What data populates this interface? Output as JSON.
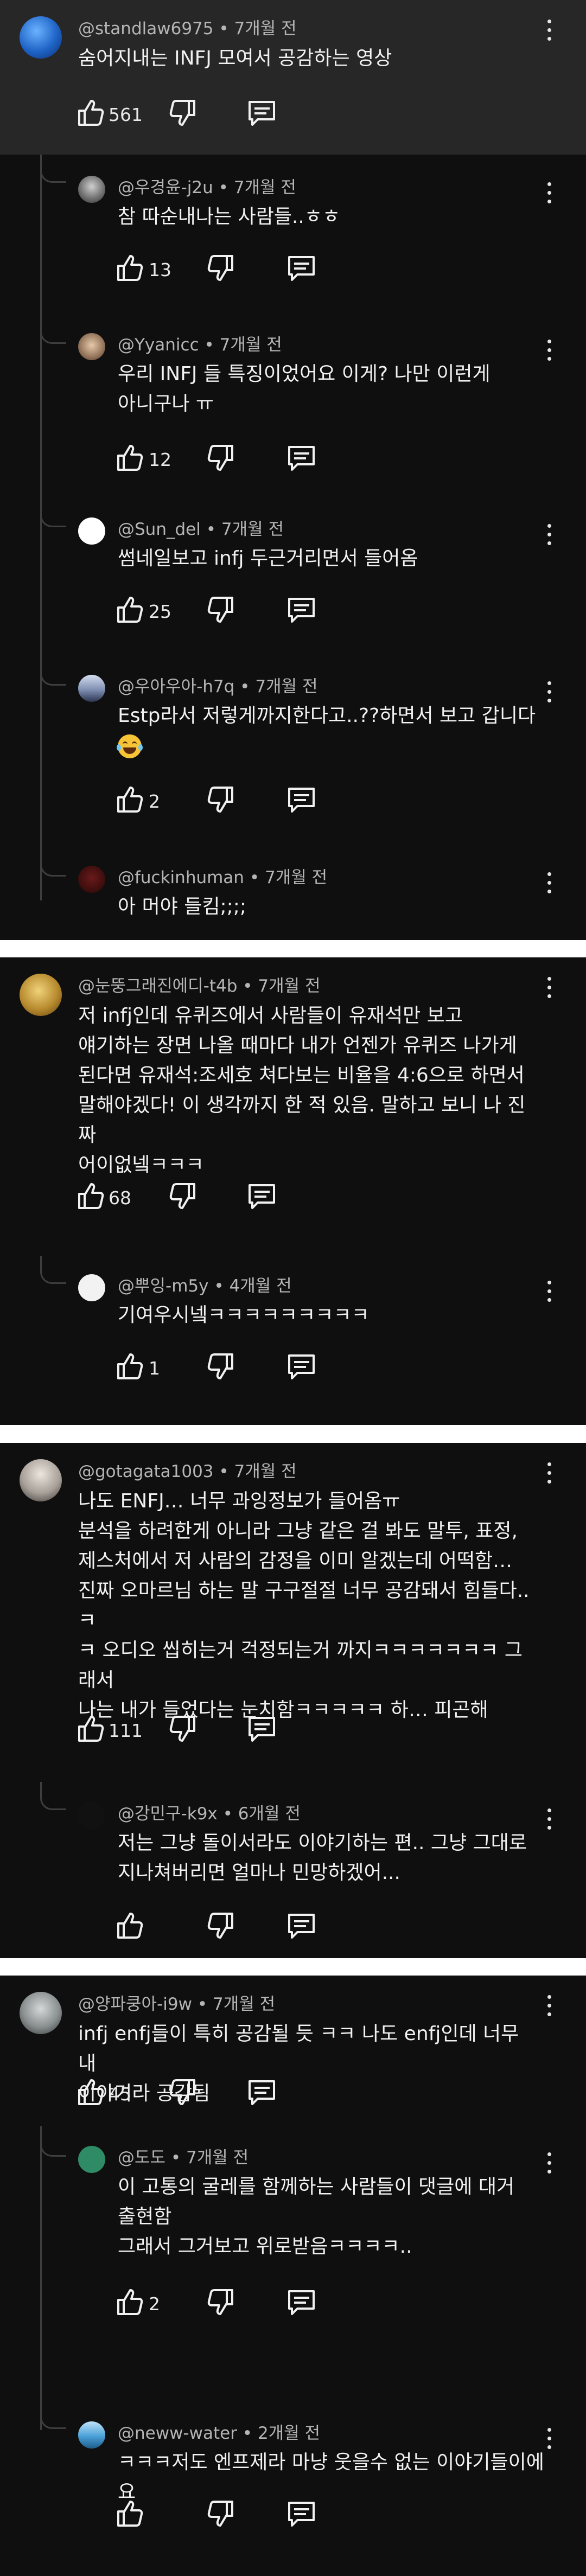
{
  "colors": {
    "background": "#0f0f0f",
    "highlight": "#272727",
    "separator": "#ffffff",
    "meta_text": "#b5b5b5",
    "body_text": "#f1f1f1"
  },
  "threads": [
    {
      "top": {
        "handle": "@standlaw6975",
        "time": "7개월 전",
        "text": "숨어지내는 INFJ 모여서 공감하는 영상",
        "likes": "561",
        "avatar_color": "#1e63c6"
      },
      "replies": [
        {
          "handle": "@우경윤-j2u",
          "time": "7개월 전",
          "text": "참 따순내나는 사람들..ㅎㅎ",
          "likes": "13",
          "avatar_color": "#7d7d7d"
        },
        {
          "handle": "@Yyanicc",
          "time": "7개월 전",
          "text": "우리 INFJ 들 특징이었어요 이게? 나만 이런게\n아니구나 ㅠ",
          "likes": "12",
          "avatar_color": "#9b7b61"
        },
        {
          "handle": "@Sun_del",
          "time": "7개월 전",
          "text": "썸네일보고 infj 두근거리면서 들어옴",
          "likes": "25",
          "avatar_color": "#ffffff"
        },
        {
          "handle": "@우아우아-h7q",
          "time": "7개월 전",
          "text": "Estp라서 저렇게까지한다고..??하면서 보고 갑니다",
          "likes": "2",
          "avatar_color": "#7f8fb3"
        },
        {
          "handle": "@fuckinhuman",
          "time": "7개월 전",
          "text": "아 머야 들킴;;;;",
          "likes": "",
          "avatar_color": "#3a0d0d"
        }
      ]
    },
    {
      "top": {
        "handle": "@눈뚱그래진에디-t4b",
        "time": "7개월 전",
        "text": "저 infj인데 유퀴즈에서 사람들이 유재석만 보고\n얘기하는 장면 나올 때마다 내가 언젠가 유퀴즈 나가게\n된다면 유재석:조세호 쳐다보는 비율을 4:6으로 하면서\n말해야겠다! 이 생각까지 한 적 있음. 말하고 보니 나 진짜\n어이없넼ㅋㅋㅋ",
        "likes": "68",
        "avatar_color": "#b88a2e"
      },
      "replies": [
        {
          "handle": "@뿌잉-m5y",
          "time": "4개월 전",
          "text": "기여우시넼ㅋㅋㅋㅋㅋㅋㅋㅋㅋ",
          "likes": "1",
          "avatar_color": "#f2f2f2"
        }
      ]
    },
    {
      "top": {
        "handle": "@gotagata1003",
        "time": "7개월 전",
        "text": "나도 ENFJ… 너무 과잉정보가 들어옴ㅠ\n분석을 하려한게 아니라 그냥 같은 걸 봐도 말투, 표정,\n제스처에서 저 사람의 감정을 이미 알겠는데 어떡함…\n진짜 오마르님 하는 말 구구절절 너무 공감돼서 힘들다.. ㅋ\nㅋ 오디오 씹히는거 걱정되는거 까지ㅋㅋㅋㅋㅋㅋㅋ 그래서\n나는 내가 들었다는 눈치함ㅋㅋㅋㅋㅋ 하… 피곤해",
        "likes": "111",
        "avatar_color": "#d9d3cc"
      },
      "replies": [
        {
          "handle": "@강민구-k9x",
          "time": "6개월 전",
          "text": "저는 그냥 돌이서라도 이야기하는 편.. 그냥 그대로\n지나쳐버리면 얼마나 민망하겠어...",
          "likes": "",
          "avatar_color": "#111111"
        }
      ]
    },
    {
      "top": {
        "handle": "@양파쿵아-i9w",
        "time": "7개월 전",
        "text": "infj enfj들이 특히 공감될 듯 ㅋㅋ 나도 enfj인데 너무 내\n이야기라 공감됨",
        "likes": "45",
        "avatar_color": "#8a8f8f"
      },
      "replies": [
        {
          "handle": "@도도",
          "time": "7개월 전",
          "text": "이 고통의 굴레를 함께하는 사람들이 댓글에 대거\n출현함\n그래서 그거보고 위로받음ㅋㅋㅋㅋ..",
          "likes": "2",
          "avatar_color": "#2f8a66"
        },
        {
          "handle": "@neww-water",
          "time": "2개월 전",
          "text": "ㅋㅋㅋ저도 엔프제라 마냥 웃을수 없는 이야기들이에요",
          "likes": "",
          "avatar_color": "#4aa0d8"
        }
      ]
    }
  ]
}
